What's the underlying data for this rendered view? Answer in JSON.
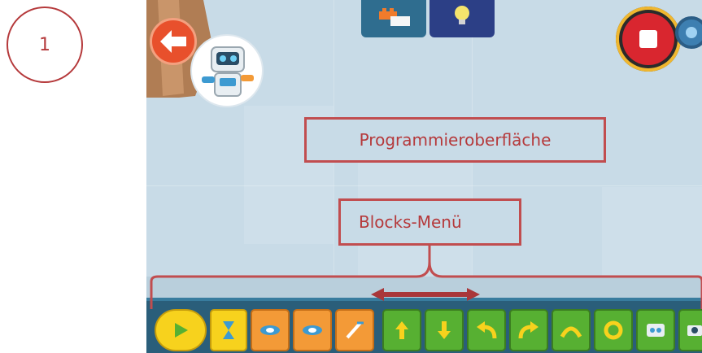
{
  "step_badge": "1",
  "tabs": [
    {
      "name": "blocks-tab"
    },
    {
      "name": "ideas-tab"
    }
  ],
  "annotations": {
    "programming_surface": "Programmieroberfläche",
    "blocks_menu": "Blocks-Menü"
  },
  "colors": {
    "background": "#c8dbe7",
    "annotation": "#c14d4f",
    "menu_bar": "#2a5e7a",
    "start_block": "#f7d21d",
    "motion_block": "#57b032",
    "sensor_block": "#f39a37"
  },
  "blocks_menu": {
    "blocks": [
      {
        "type": "start",
        "icon": "play-icon"
      },
      {
        "type": "wait",
        "icon": "hourglass-icon"
      },
      {
        "type": "sensor",
        "icon": "hand-sensor-icon"
      },
      {
        "type": "sensor",
        "icon": "hand-sensor-2-icon"
      },
      {
        "type": "sensor",
        "icon": "distance-sensor-icon"
      },
      {
        "type": "motion",
        "icon": "arrow-up-icon"
      },
      {
        "type": "motion",
        "icon": "arrow-down-icon"
      },
      {
        "type": "motion",
        "icon": "turn-left-icon"
      },
      {
        "type": "motion",
        "icon": "turn-right-icon"
      },
      {
        "type": "motion",
        "icon": "arc-icon"
      },
      {
        "type": "motion",
        "icon": "spin-icon"
      },
      {
        "type": "motion",
        "icon": "robot-icon"
      },
      {
        "type": "motion",
        "icon": "camera-icon"
      }
    ]
  }
}
